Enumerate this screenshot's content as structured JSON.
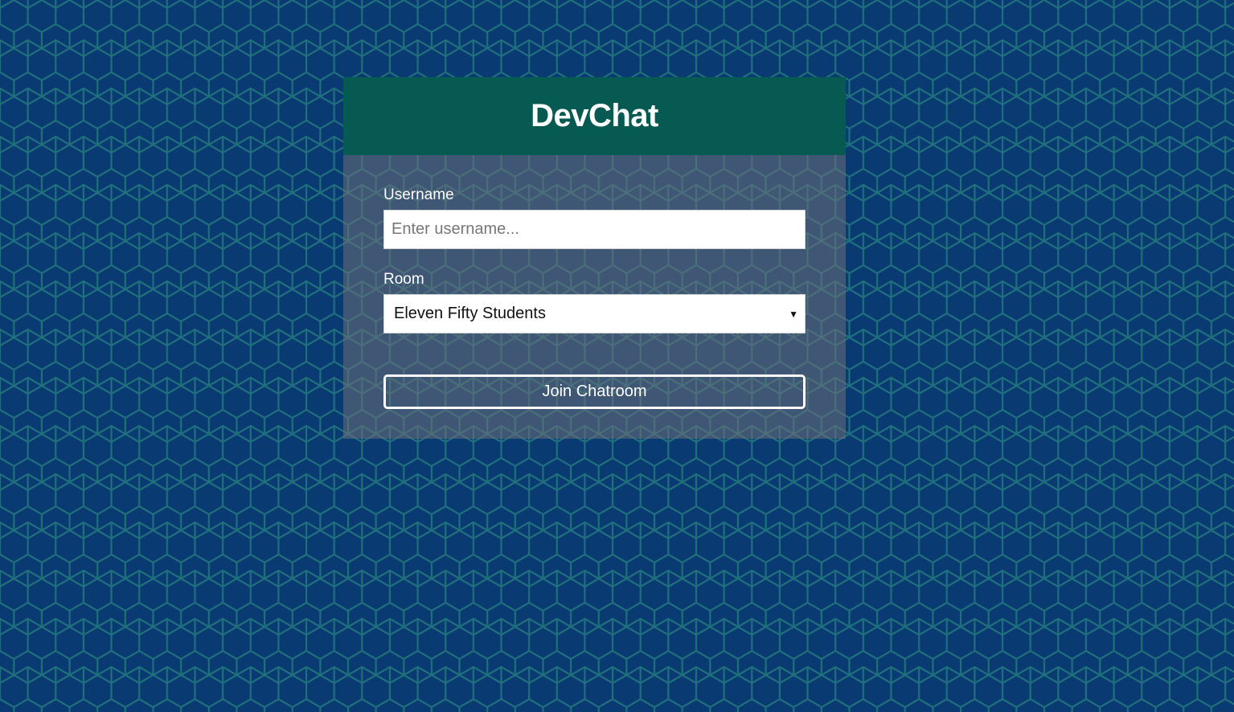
{
  "app": {
    "title": "DevChat"
  },
  "form": {
    "username_label": "Username",
    "username_placeholder": "Enter username...",
    "username_value": "",
    "room_label": "Room",
    "room_selected": "Eleven Fifty Students",
    "join_label": "Join Chatroom"
  },
  "icons": {
    "select_caret": "chevron-down-icon",
    "background": "hexagon-pattern"
  },
  "colors": {
    "background": "#0a3a72",
    "hex_outline": "#1f6f7c",
    "header": "#065a51",
    "card_body": "rgba(110,110,120,0.55)",
    "text": "#ffffff"
  }
}
